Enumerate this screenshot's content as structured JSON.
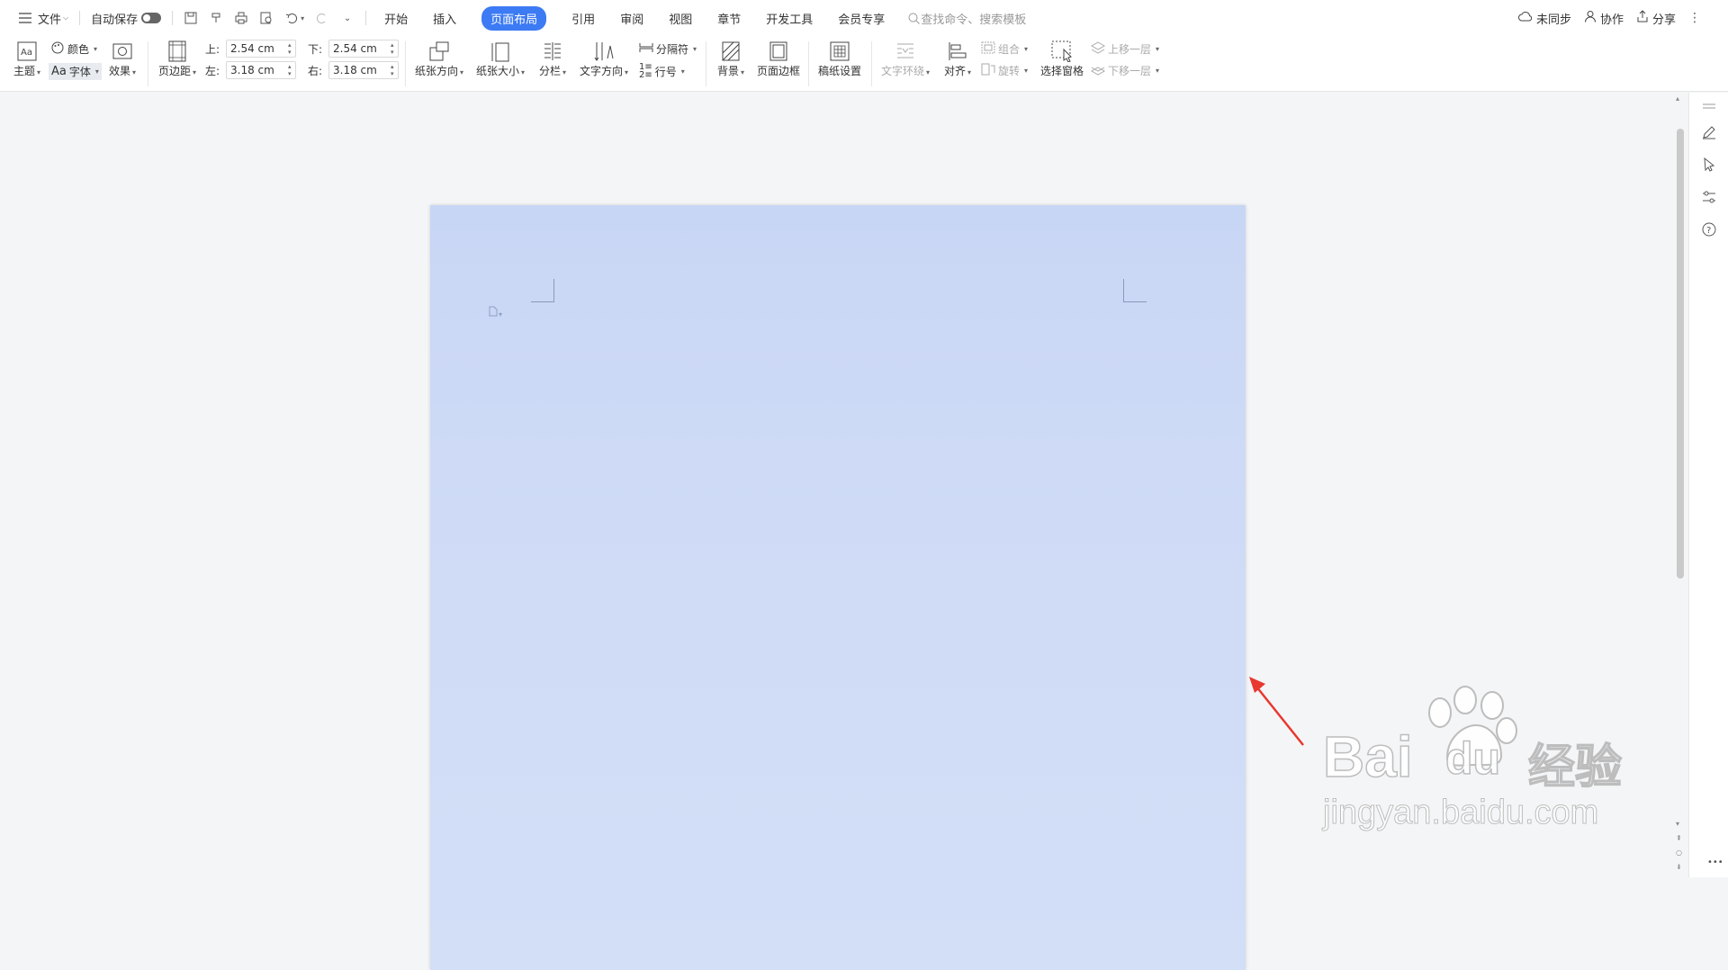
{
  "topbar": {
    "menu_label": "文件",
    "autosave_label": "自动保存",
    "tabs": [
      "开始",
      "插入",
      "页面布局",
      "引用",
      "审阅",
      "视图",
      "章节",
      "开发工具",
      "会员专享"
    ],
    "active_tab": "页面布局",
    "search_placeholder": "查找命令、搜索模板",
    "sync_label": "未同步",
    "collab_label": "协作",
    "share_label": "分享"
  },
  "ribbon": {
    "theme_label": "主题",
    "color_label": "颜色",
    "font_label": "字体",
    "effect_label": "效果",
    "margins_label": "页边距",
    "margin_top_label": "上:",
    "margin_top_value": "2.54 cm",
    "margin_bottom_label": "下:",
    "margin_bottom_value": "2.54 cm",
    "margin_left_label": "左:",
    "margin_left_value": "3.18 cm",
    "margin_right_label": "右:",
    "margin_right_value": "3.18 cm",
    "orientation_label": "纸张方向",
    "size_label": "纸张大小",
    "columns_label": "分栏",
    "text_direction_label": "文字方向",
    "separator_label": "分隔符",
    "line_number_label": "行号",
    "background_label": "背景",
    "page_border_label": "页面边框",
    "manuscript_label": "稿纸设置",
    "text_wrap_label": "文字环绕",
    "align_label": "对齐",
    "group_label": "组合",
    "rotate_label": "旋转",
    "select_pane_label": "选择窗格",
    "bring_forward_label": "上移一层",
    "send_backward_label": "下移一层"
  },
  "watermark": {
    "brand": "Bai",
    "brand_tail": "du",
    "cn": "经验",
    "url": "jingyan.baidu.com"
  },
  "colors": {
    "accent": "#3d7bf4",
    "page_bg": "#cfdbf6",
    "annotation_arrow": "#e8382f"
  }
}
